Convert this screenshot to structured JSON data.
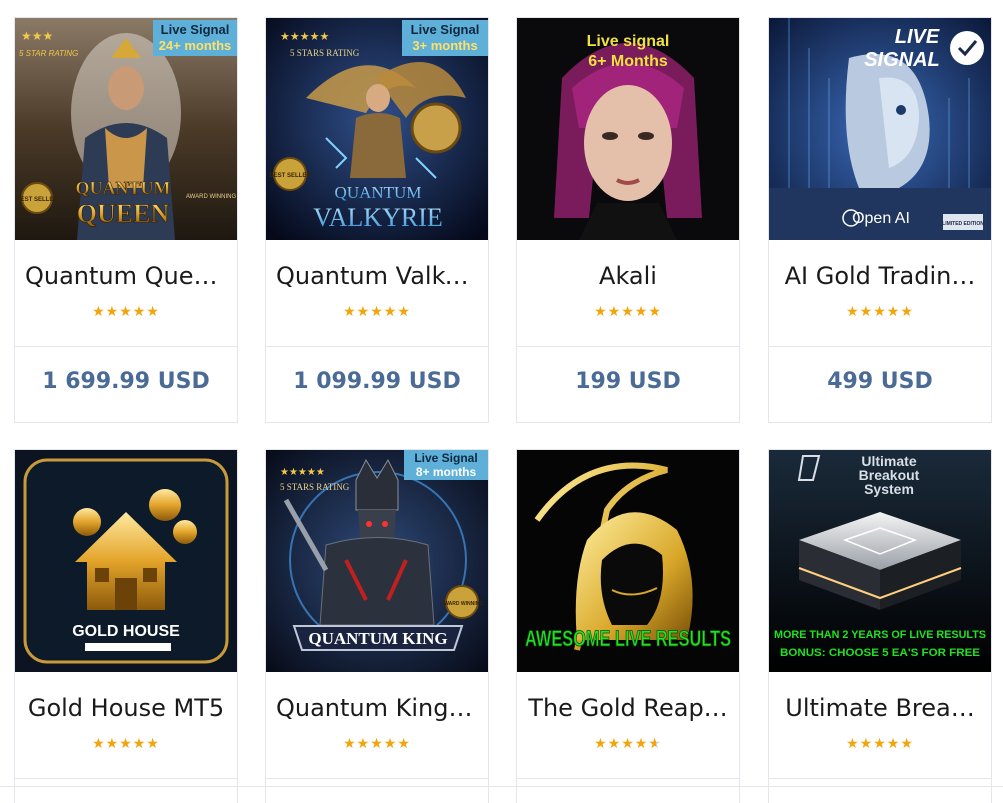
{
  "products": [
    {
      "title": "Quantum Quee…",
      "rating": 5,
      "price": "1 699.99 USD",
      "banner": {
        "line1": "Live Signal",
        "line2": "24+ months"
      },
      "corner_text": "5 STAR RATING",
      "badge_text": "BEST SELLER",
      "award_text": "AWARD WINNING",
      "logo_line1": "QUANTUM",
      "logo_line2": "QUEEN"
    },
    {
      "title": "Quantum Valky…",
      "rating": 5,
      "price": "1 099.99 USD",
      "banner": {
        "line1": "Live Signal",
        "line2": "3+ months"
      },
      "corner_text": "5 STARS RATING",
      "badge_text": "BEST SELLER",
      "logo_line1": "QUANTUM",
      "logo_line2": "VALKYRIE"
    },
    {
      "title": "Akali",
      "rating": 5,
      "price": "199 USD",
      "banner": {
        "line1": "Live signal",
        "line2": "6+ Months"
      }
    },
    {
      "title": "AI Gold Tradin…",
      "rating": 5,
      "price": "499 USD",
      "banner": {
        "line1": "LIVE",
        "line2": "SIGNAL"
      },
      "logo_text": "Open AI",
      "edition_text": "LIMITED EDITION"
    },
    {
      "title": "Gold House MT5",
      "rating": 5,
      "logo_text": "GOLD HOUSE"
    },
    {
      "title": "Quantum King …",
      "rating": 5,
      "banner": {
        "line1": "Live Signal",
        "line2": "8+ months"
      },
      "corner_text": "5 STARS RATING",
      "award_text": "AWARD WINNING",
      "logo_text": "QUANTUM KING"
    },
    {
      "title": "The Gold Reap…",
      "rating": 4.5,
      "logo_text": "AWESOME LIVE RESULTS"
    },
    {
      "title": "Ultimate Brea…",
      "rating": 5,
      "header_line1": "Ultimate",
      "header_line2": "Breakout",
      "header_line3": "System",
      "footer_line1": "MORE THAN 2 YEARS OF LIVE RESULTS",
      "footer_line2": "BONUS: CHOOSE 5 EA'S FOR FREE"
    }
  ],
  "colors": {
    "price": "#4a6b96",
    "star": "#f2a40b",
    "border": "#e3e6ea"
  }
}
